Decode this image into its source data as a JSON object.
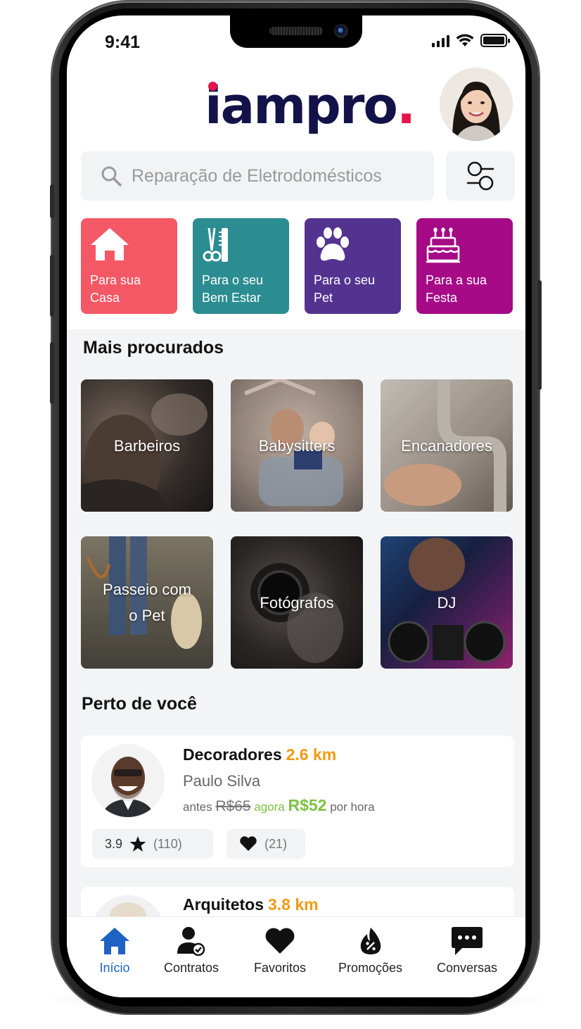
{
  "status": {
    "time": "9:41"
  },
  "brand": {
    "logo_text": "iampro",
    "logo_dot": ".",
    "accent": "#e4154b",
    "navy": "#13134a"
  },
  "search": {
    "placeholder": "Reparação de Eletrodomésticos",
    "icon": "search-icon"
  },
  "filter": {
    "icon": "filter-icon"
  },
  "categories": [
    {
      "label_line1": "Para sua",
      "label_line2": "Casa",
      "color": "#f55865",
      "icon": "house-icon"
    },
    {
      "label_line1": "Para o seu",
      "label_line2": "Bem Estar",
      "color": "#2b8d92",
      "icon": "scissors-comb-icon"
    },
    {
      "label_line1": "Para o seu",
      "label_line2": "Pet",
      "color": "#53338f",
      "icon": "paw-icon"
    },
    {
      "label_line1": "Para a sua",
      "label_line2": "Festa",
      "color": "#a60a86",
      "icon": "cake-icon"
    }
  ],
  "popular": {
    "title": "Mais procurados",
    "items": [
      {
        "label": "Barbeiros"
      },
      {
        "label": "Babysitters"
      },
      {
        "label": "Encanadores"
      },
      {
        "label_line1": "Passeio com",
        "label_line2": "o Pet"
      },
      {
        "label": "Fotógrafos"
      },
      {
        "label": "DJ"
      }
    ]
  },
  "nearby": {
    "title": "Perto de você",
    "cards": [
      {
        "category": "Decoradores",
        "distance": "2.6 km",
        "name": "Paulo Silva",
        "before_label": "antes",
        "old_price": "R$65",
        "now_label": "agora",
        "new_price": "R$52",
        "per": "por hora",
        "rating": "3.9",
        "reviews": "(110)",
        "likes": "(21)"
      },
      {
        "category": "Arquitetos",
        "distance": "3.8 km"
      }
    ]
  },
  "tabbar": {
    "active_color": "#1e63c4",
    "tabs": [
      {
        "label": "Início",
        "icon": "home-icon"
      },
      {
        "label": "Contratos",
        "icon": "contract-user-icon"
      },
      {
        "label": "Favoritos",
        "icon": "heart-icon"
      },
      {
        "label": "Promoções",
        "icon": "promo-flame-icon"
      },
      {
        "label": "Conversas",
        "icon": "chat-icon"
      }
    ]
  }
}
